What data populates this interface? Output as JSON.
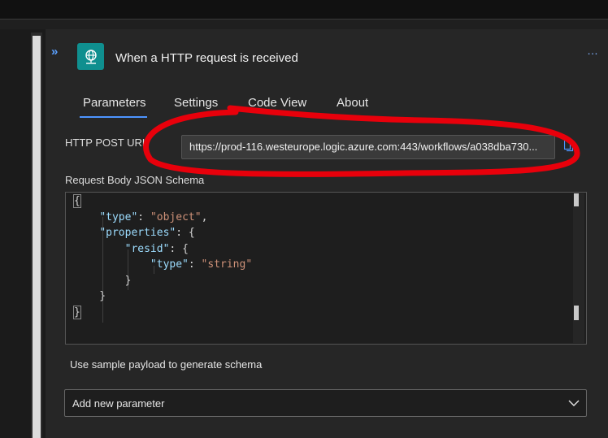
{
  "trigger": {
    "title": "When a HTTP request is received",
    "icon": "http-globe-icon",
    "more_label": "…",
    "accent_color": "#0f8f8f"
  },
  "tabs": [
    {
      "label": "Parameters",
      "active": true
    },
    {
      "label": "Settings",
      "active": false
    },
    {
      "label": "Code View",
      "active": false
    },
    {
      "label": "About",
      "active": false
    }
  ],
  "fields": {
    "http_post_url_label": "HTTP POST URL",
    "http_post_url_value": "https://prod-116.westeurope.logic.azure.com:443/workflows/a038dba730...",
    "schema_label": "Request Body JSON Schema"
  },
  "schema_lines": [
    [
      "{"
    ],
    [
      "    ",
      "\"type\"",
      ": ",
      "\"object\"",
      ","
    ],
    [
      "    ",
      "\"properties\"",
      ": {"
    ],
    [
      "        ",
      "\"resid\"",
      ": {"
    ],
    [
      "            ",
      "\"type\"",
      ": ",
      "\"string\""
    ],
    [
      "        }"
    ],
    [
      "    }"
    ],
    [
      "}"
    ]
  ],
  "sample_payload_label": "Use sample payload to generate schema",
  "add_param": {
    "label": "Add new parameter"
  },
  "annotation_color": "#e8000b"
}
